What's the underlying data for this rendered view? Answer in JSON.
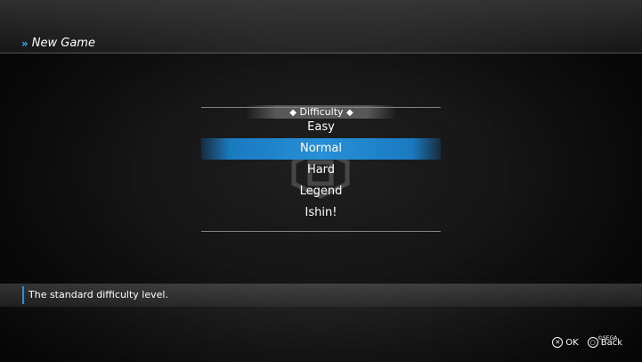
{
  "header": {
    "title": "New Game",
    "icon": "double-chevron-icon"
  },
  "menu": {
    "title": "Difficulty",
    "title_icon": "diamond-icon",
    "items": [
      {
        "label": "Easy",
        "selected": false
      },
      {
        "label": "Normal",
        "selected": true
      },
      {
        "label": "Hard",
        "selected": false
      },
      {
        "label": "Legend",
        "selected": false
      },
      {
        "label": "Ishin!",
        "selected": false
      }
    ]
  },
  "description": {
    "text": "The standard difficulty level."
  },
  "footer": {
    "ok_label": "OK",
    "back_label": "Back",
    "copyright": "©SEGA"
  },
  "colors": {
    "accent": "#2790d8",
    "chevron": "#4aa8e8"
  }
}
